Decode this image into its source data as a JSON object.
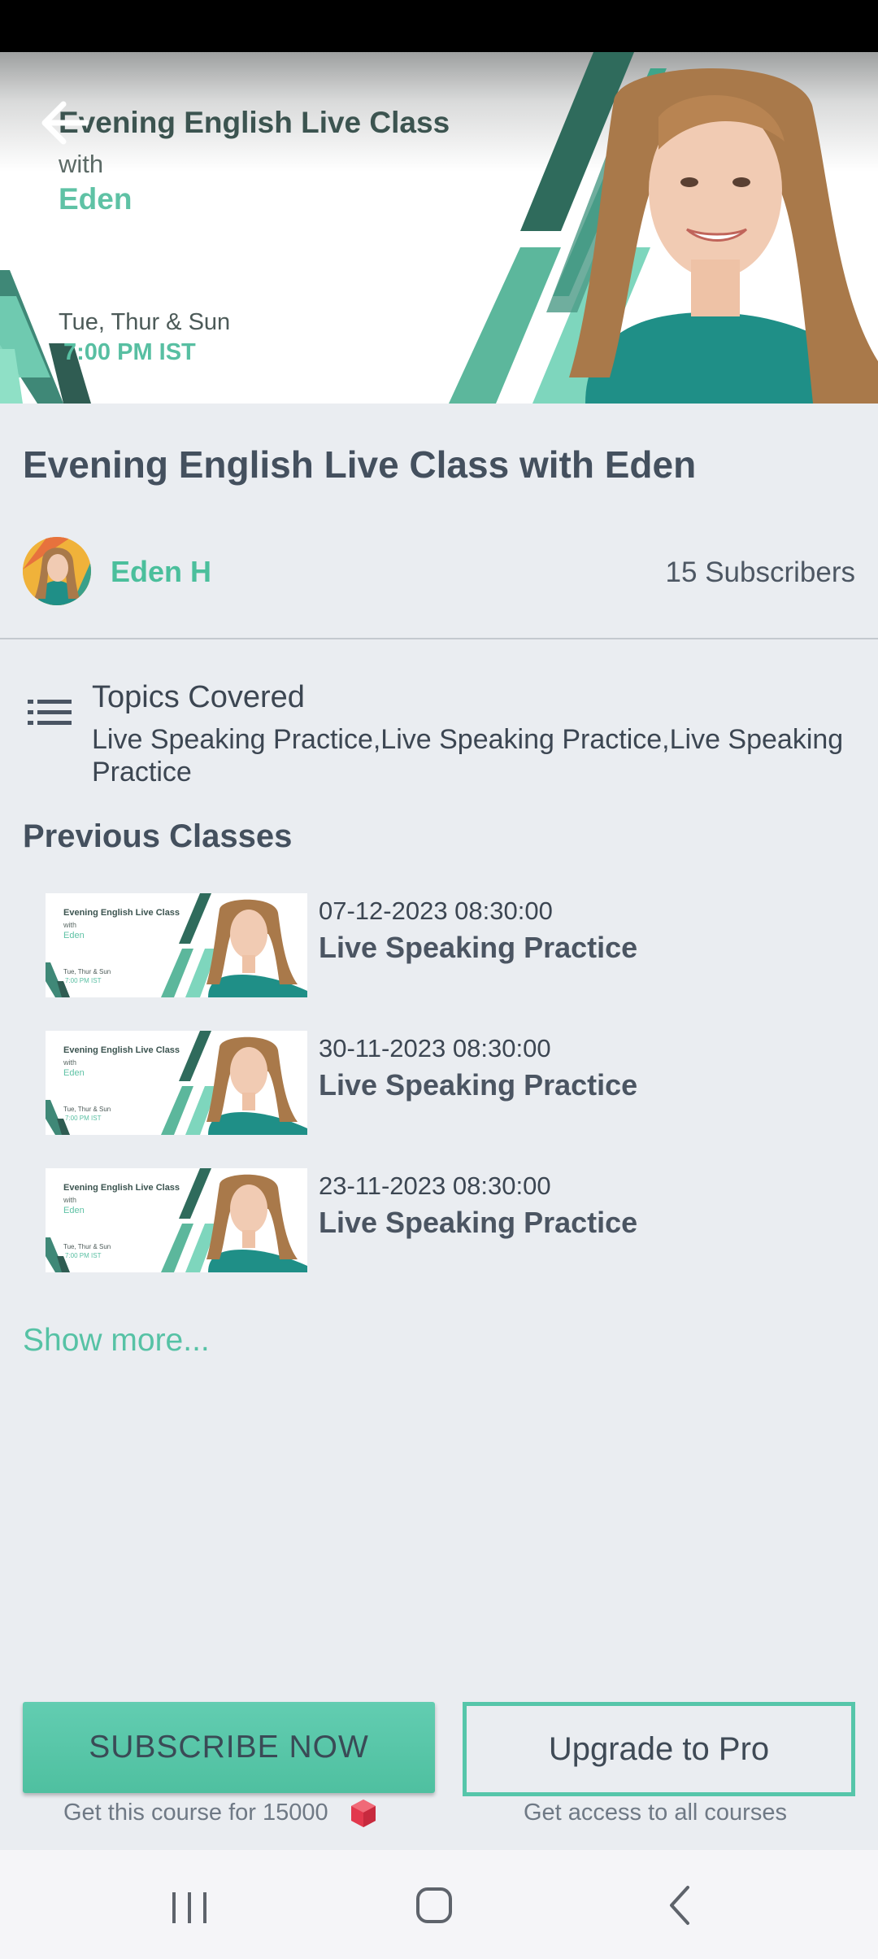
{
  "banner": {
    "title": "Evening English Live Class",
    "with": "with",
    "name": "Eden",
    "days": "Tue, Thur & Sun",
    "time": "7:00 PM IST",
    "back_icon": "back-arrow-icon"
  },
  "course": {
    "title": "Evening English Live Class with Eden",
    "author": "Eden H",
    "subscribers": "15 Subscribers"
  },
  "topics": {
    "heading": "Topics Covered",
    "text": "Live Speaking Practice,Live Speaking Practice,Live Speaking Practice",
    "icon": "list-icon"
  },
  "previous": {
    "heading": "Previous Classes",
    "items": [
      {
        "date": "07-12-2023 08:30:00",
        "title": "Live Speaking Practice"
      },
      {
        "date": "30-11-2023 08:30:00",
        "title": "Live Speaking Practice"
      },
      {
        "date": "23-11-2023 08:30:00",
        "title": "Live Speaking Practice"
      }
    ],
    "show_more": "Show more..."
  },
  "thumb": {
    "title": "Evening English Live Class",
    "with": "with",
    "name": "Eden",
    "days": "Tue, Thur & Sun",
    "time": "7:00 PM IST"
  },
  "actions": {
    "subscribe_label": "SUBSCRIBE NOW",
    "subscribe_note": "Get this course for 15000",
    "upgrade_label": "Upgrade to Pro",
    "upgrade_note": "Get access to all courses"
  },
  "nav": {
    "recents_icon": "recents-icon",
    "home_icon": "home-icon",
    "back_icon": "back-icon"
  },
  "colors": {
    "accent": "#4fc0a0",
    "background": "#eaedf1",
    "text": "#44505e",
    "gem": "#e2384d"
  }
}
